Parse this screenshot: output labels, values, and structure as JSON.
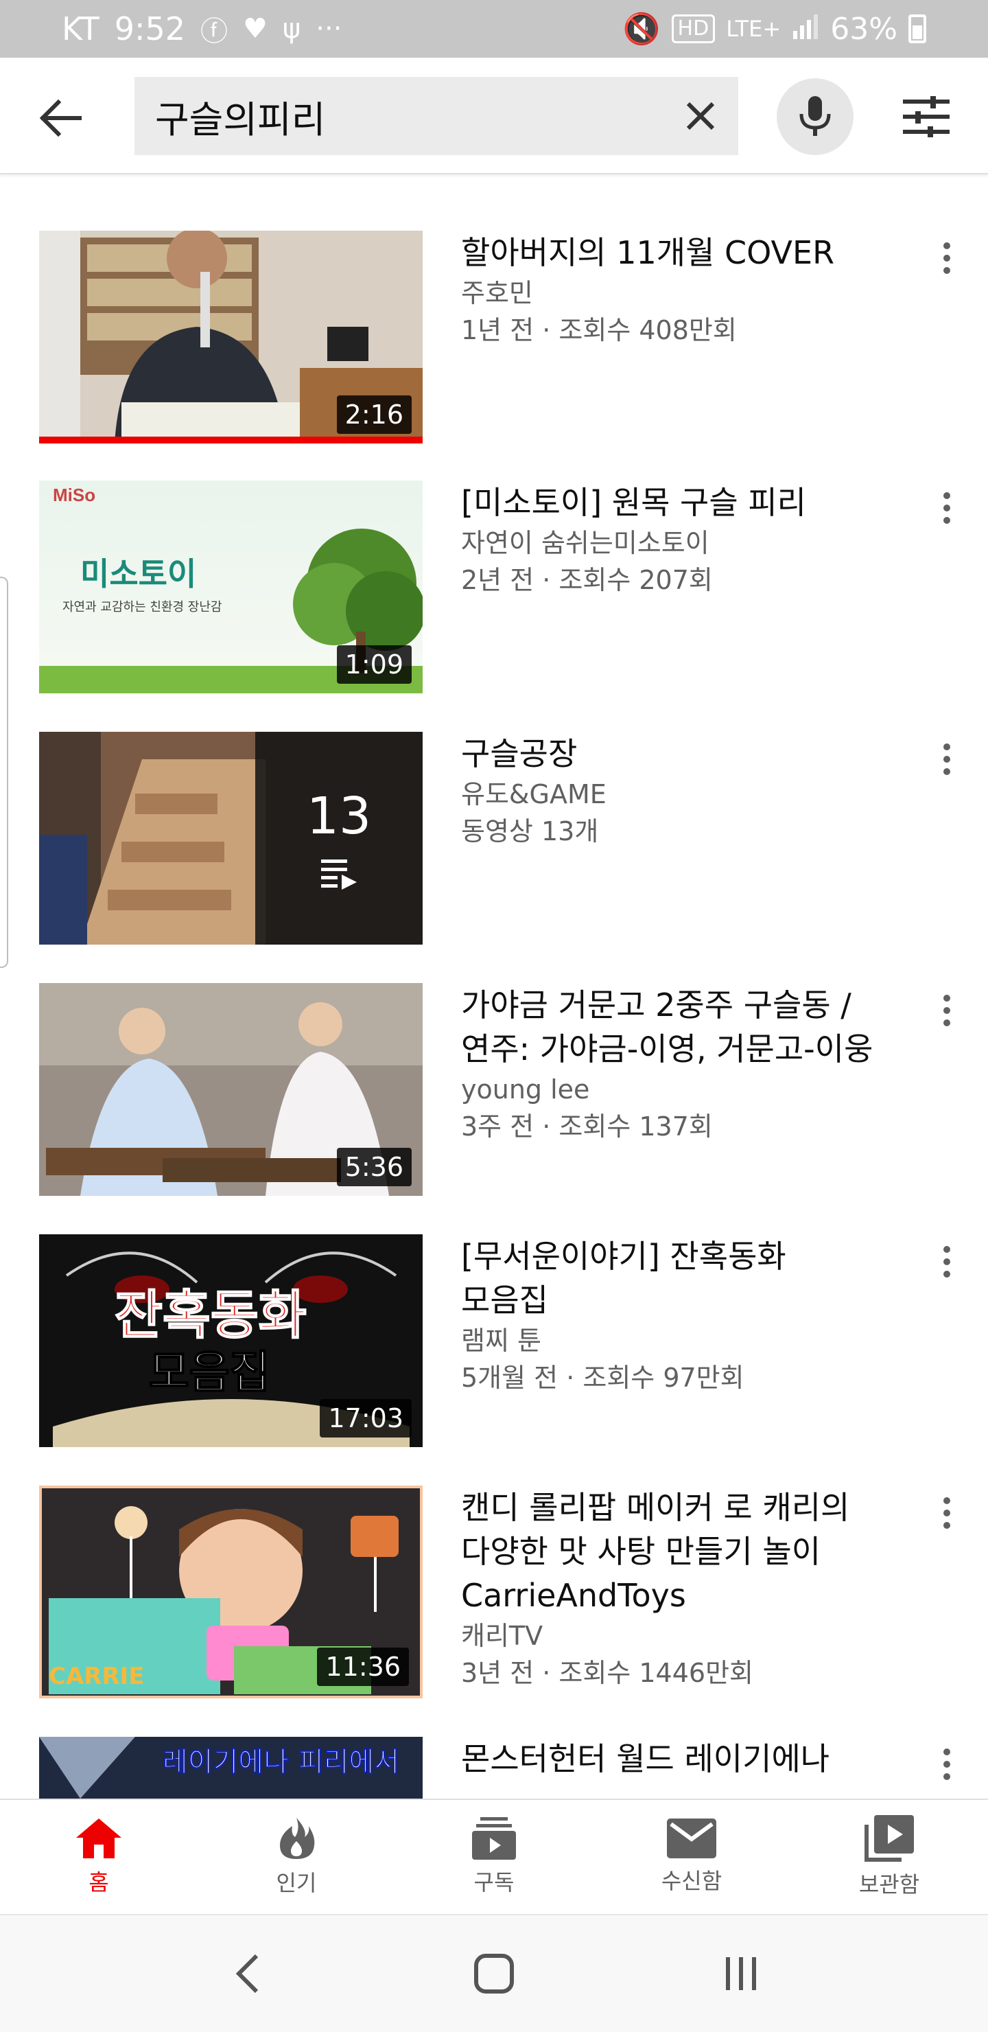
{
  "status_bar": {
    "carrier": "KT",
    "time": "9:52",
    "network": "LTE+",
    "hd": "HD",
    "battery": "63%"
  },
  "search": {
    "query": "구슬의피리",
    "back_icon": "arrow-back-icon",
    "clear_icon": "close-icon",
    "mic_icon": "mic-icon",
    "filter_icon": "filter-icon"
  },
  "results": [
    {
      "title": "할아버지의 11개월 COVER",
      "channel": "주호민",
      "stats": "1년 전 · 조회수 408만회",
      "duration": "2:16",
      "watched": 1.0
    },
    {
      "title": "[미소토이] 원목 구슬 피리",
      "channel": "자연이 숨쉬는미소토이",
      "stats": "2년 전 · 조회수 207회",
      "duration": "1:09",
      "thumb_text": "미소토이",
      "thumb_sub": "자연과 교감하는 친환경 장난감"
    },
    {
      "title": "구슬공장",
      "channel": "유도&GAME",
      "stats": "동영상 13개",
      "playlist_count": "13"
    },
    {
      "title_line1": "가야금 거문고 2중주 구슬동 /",
      "title_line2": "연주: 가야금-이영, 거문고-이웅",
      "channel": "young lee",
      "stats": "3주 전 · 조회수 137회",
      "duration": "5:36"
    },
    {
      "title_line1": "[무서운이야기] 잔혹동화",
      "title_line2": "모음집",
      "channel": "램찌 툰",
      "stats": "5개월 전 · 조회수 97만회",
      "duration": "17:03",
      "thumb_text1": "잔혹동화",
      "thumb_text2": "모음집"
    },
    {
      "title_line1": "캔디 롤리팝 메이커 로 캐리의",
      "title_line2": "다양한 맛 사탕 만들기 놀이",
      "title_line3": "CarrieAndToys",
      "channel": "캐리TV",
      "stats": "3년 전 · 조회수 1446만회",
      "duration": "11:36",
      "thumb_text": "CARRIE"
    },
    {
      "title_line1": "몬스터헌터 월드 레이기에나",
      "thumb_text": "레이기에나 피리에서"
    }
  ],
  "bottom_nav": [
    {
      "label": "홈",
      "icon": "home-icon"
    },
    {
      "label": "인기",
      "icon": "fire-icon"
    },
    {
      "label": "구독",
      "icon": "subscriptions-icon"
    },
    {
      "label": "수신함",
      "icon": "mail-icon"
    },
    {
      "label": "보관함",
      "icon": "library-icon"
    }
  ],
  "colors": {
    "accent": "#ee0000",
    "secondary_text": "#606060"
  }
}
